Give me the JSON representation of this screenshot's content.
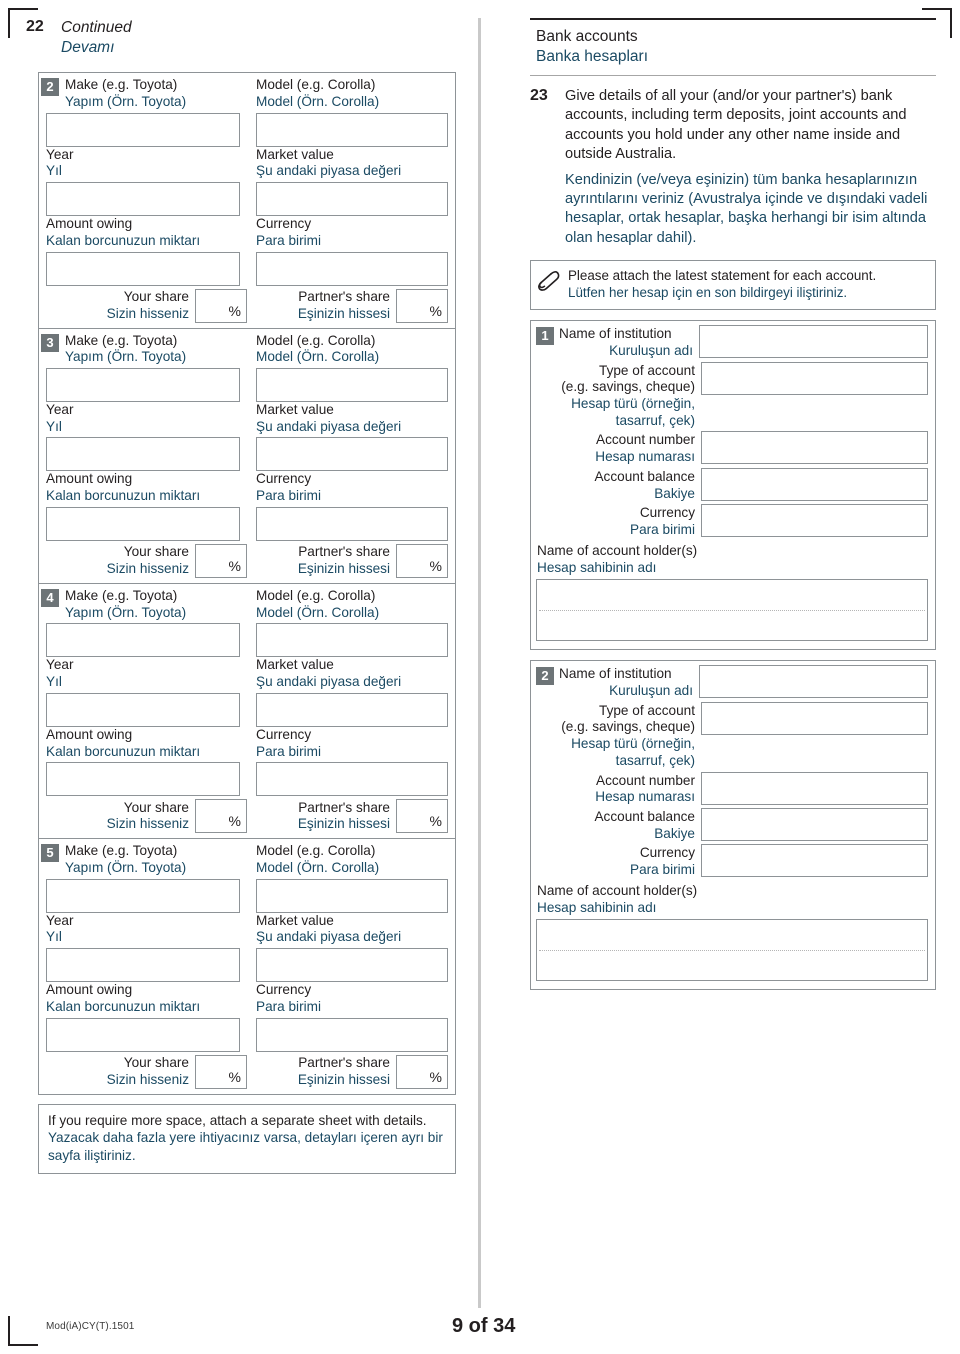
{
  "doc": {
    "footer_code": "Mod(iA)CY(T).1501",
    "page_label": "9 of 34"
  },
  "left": {
    "continued": {
      "number": "22",
      "en": "Continued",
      "tr": "Devamı"
    },
    "field_labels": {
      "make_en": "Make (e.g. Toyota)",
      "make_tr": "Yapım (Örn. Toyota)",
      "model_en": "Model (e.g. Corolla)",
      "model_tr": "Model (Örn. Corolla)",
      "year_en": "Year",
      "year_tr": "Yıl",
      "market_value_en": "Market value",
      "market_value_tr": "Şu andaki piyasa değeri",
      "amount_owing_en": "Amount owing",
      "amount_owing_tr": "Kalan borcunuzun miktarı",
      "currency_en": "Currency",
      "currency_tr": "Para birimi",
      "your_share_en": "Your share",
      "your_share_tr": "Sizin hisseniz",
      "partner_share_en": "Partner's share",
      "partner_share_tr": "Eşinizin hissesi",
      "percent_symbol": "%"
    },
    "vehicle_blocks": [
      {
        "marker": "2",
        "make": "",
        "model": "",
        "year": "",
        "market_value": "",
        "amount_owing": "",
        "currency": "",
        "your_share": "",
        "partner_share": ""
      },
      {
        "marker": "3",
        "make": "",
        "model": "",
        "year": "",
        "market_value": "",
        "amount_owing": "",
        "currency": "",
        "your_share": "",
        "partner_share": ""
      },
      {
        "marker": "4",
        "make": "",
        "model": "",
        "year": "",
        "market_value": "",
        "amount_owing": "",
        "currency": "",
        "your_share": "",
        "partner_share": ""
      },
      {
        "marker": "5",
        "make": "",
        "model": "",
        "year": "",
        "market_value": "",
        "amount_owing": "",
        "currency": "",
        "your_share": "",
        "partner_share": ""
      }
    ],
    "more_space_note": {
      "en": "If you require more space, attach a separate sheet with details.",
      "tr": "Yazacak daha fazla yere ihtiyacınız varsa, detayları içeren ayrı bir sayfa iliştiriniz."
    }
  },
  "right": {
    "section": {
      "title_en": "Bank accounts",
      "title_tr": "Banka hesapları"
    },
    "question23": {
      "number": "23",
      "en": "Give details of all your (and/or your partner's) bank accounts, including term deposits, joint accounts and accounts you hold under any other name inside and outside Australia.",
      "tr": "Kendinizin (ve/veya eşinizin) tüm banka hesaplarınızın ayrıntılarını veriniz (Avustralya içinde ve dışındaki vadeli hesaplar, ortak hesaplar, başka herhangi bir isim altında olan hesaplar dahil)."
    },
    "attach_note": {
      "icon": "paperclip-icon",
      "en": "Please attach the latest statement for each account.",
      "tr": "Lütfen her hesap için en son bildirgeyi iliştiriniz."
    },
    "account_labels": {
      "institution_en": "Name of institution",
      "institution_tr": "Kuruluşun adı",
      "type_en_1": "Type of account",
      "type_en_2": "(e.g. savings, cheque)",
      "type_tr_1": "Hesap türü (örneğin,",
      "type_tr_2": "tasarruf, çek)",
      "number_en": "Account number",
      "number_tr": "Hesap numarası",
      "balance_en": "Account balance",
      "balance_tr": "Bakiye",
      "currency_en": "Currency",
      "currency_tr": "Para birimi",
      "holder_en": "Name of account holder(s)",
      "holder_tr": "Hesap sahibinin adı"
    },
    "accounts": [
      {
        "marker": "1",
        "institution": "",
        "type": "",
        "number": "",
        "balance": "",
        "currency": "",
        "holder": ""
      },
      {
        "marker": "2",
        "institution": "",
        "type": "",
        "number": "",
        "balance": "",
        "currency": "",
        "holder": ""
      }
    ]
  }
}
